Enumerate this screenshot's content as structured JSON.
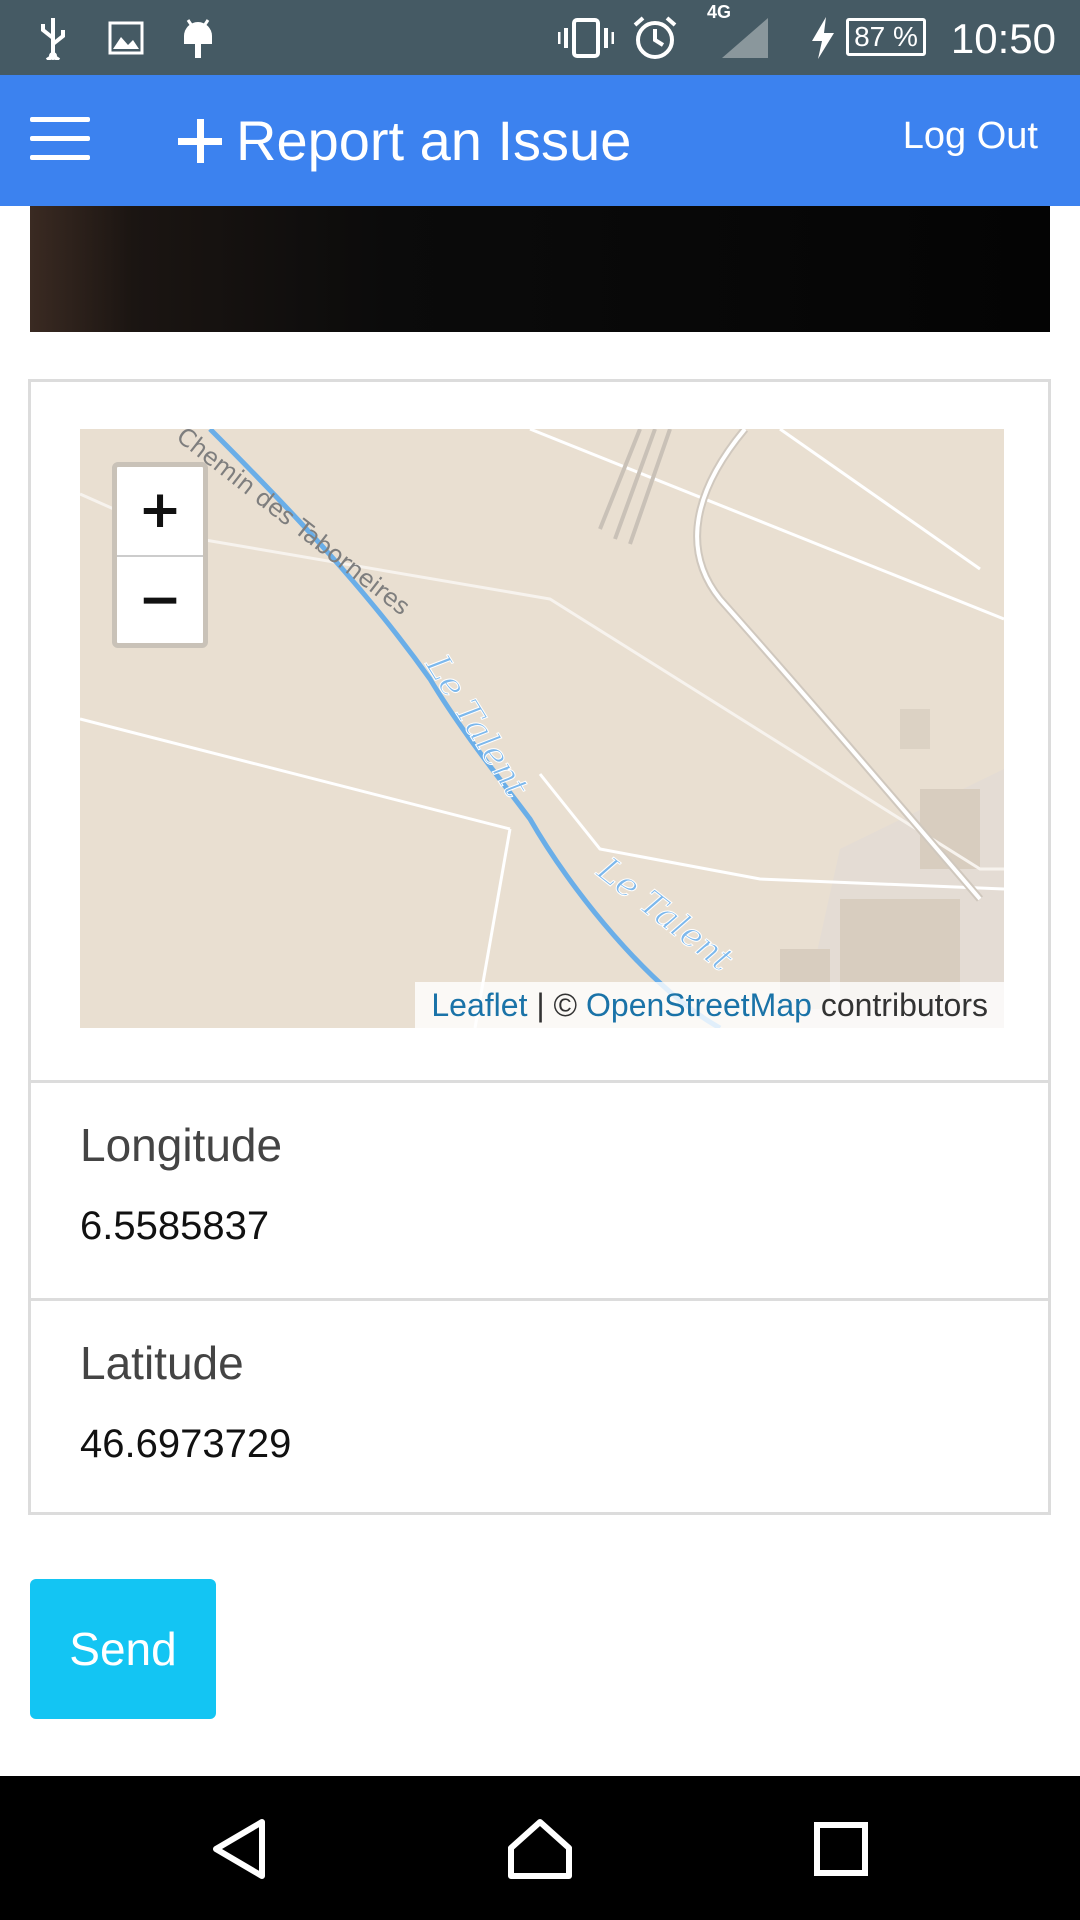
{
  "status_bar": {
    "time": "10:50",
    "battery_label": "87 %",
    "network_label": "4G",
    "icons": [
      "usb-icon",
      "image-icon",
      "android-icon",
      "vibrate-icon",
      "alarm-icon",
      "signal-icon",
      "charging-icon",
      "battery-icon"
    ]
  },
  "app_bar": {
    "title": "Report an Issue",
    "logout_label": "Log Out",
    "color": "#3c82ef"
  },
  "map": {
    "zoom_in_label": "+",
    "zoom_out_label": "−",
    "street_label": "Chemin des Taborneires",
    "river_label": "Le Talent",
    "attribution_leaflet": "Leaflet",
    "attribution_sep": " | © ",
    "attribution_osm": "OpenStreetMap",
    "attribution_suffix": " contributors"
  },
  "location": {
    "longitude_label": "Longitude",
    "longitude_value": "6.5585837",
    "latitude_label": "Latitude",
    "latitude_value": "46.6973729"
  },
  "actions": {
    "send_label": "Send",
    "send_color": "#13c5f3"
  }
}
